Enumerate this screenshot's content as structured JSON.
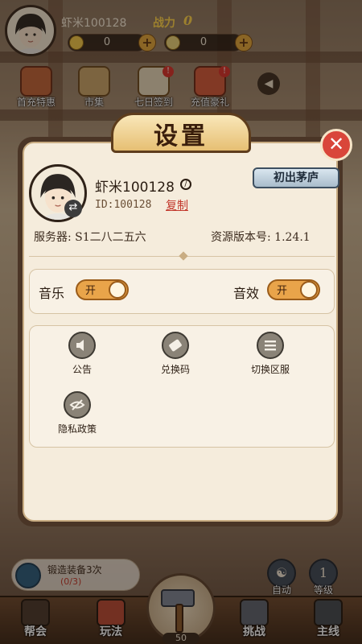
{
  "hud": {
    "player_name": "虾米100128",
    "power_label": "战力",
    "power_value": "0",
    "currency_1": "0",
    "currency_2": "0"
  },
  "top_icons": [
    {
      "label": "首充特惠",
      "badge": ""
    },
    {
      "label": "市集",
      "badge": ""
    },
    {
      "label": "七日签到",
      "badge": "!"
    },
    {
      "label": "充值豪礼",
      "badge": "!"
    }
  ],
  "dialog": {
    "title": "设置",
    "close_icon": "close-icon",
    "profile": {
      "name": "虾米100128",
      "id": "ID:100128",
      "copy_label": "复制",
      "title_badge": "初出茅庐"
    },
    "server_label": "服务器: S1二八二五六",
    "version_label": "资源版本号:  1.24.1",
    "toggles": [
      {
        "label": "音乐",
        "state": "开"
      },
      {
        "label": "音效",
        "state": "开"
      }
    ],
    "menu": [
      {
        "label": "公告",
        "icon": "speaker-icon"
      },
      {
        "label": "兑换码",
        "icon": "ticket-icon"
      },
      {
        "label": "切换区服",
        "icon": "list-icon"
      },
      {
        "label": "隐私政策",
        "icon": "eye-off-icon"
      }
    ]
  },
  "task": {
    "text": "锻造装备3次",
    "progress": "(0/3)"
  },
  "side_buttons": [
    {
      "label": "自动",
      "value": ""
    },
    {
      "label": "等级",
      "value": "1"
    }
  ],
  "bottom_nav": [
    {
      "label": "帮会"
    },
    {
      "label": "玩法"
    },
    {
      "label": "挑战"
    },
    {
      "label": "主线"
    }
  ],
  "hammer_count": "50",
  "colors": {
    "accent": "#e9a44a",
    "close_red": "#d9463a",
    "link_red": "#c2382c",
    "dialog_bg": "#f5ecdc"
  }
}
